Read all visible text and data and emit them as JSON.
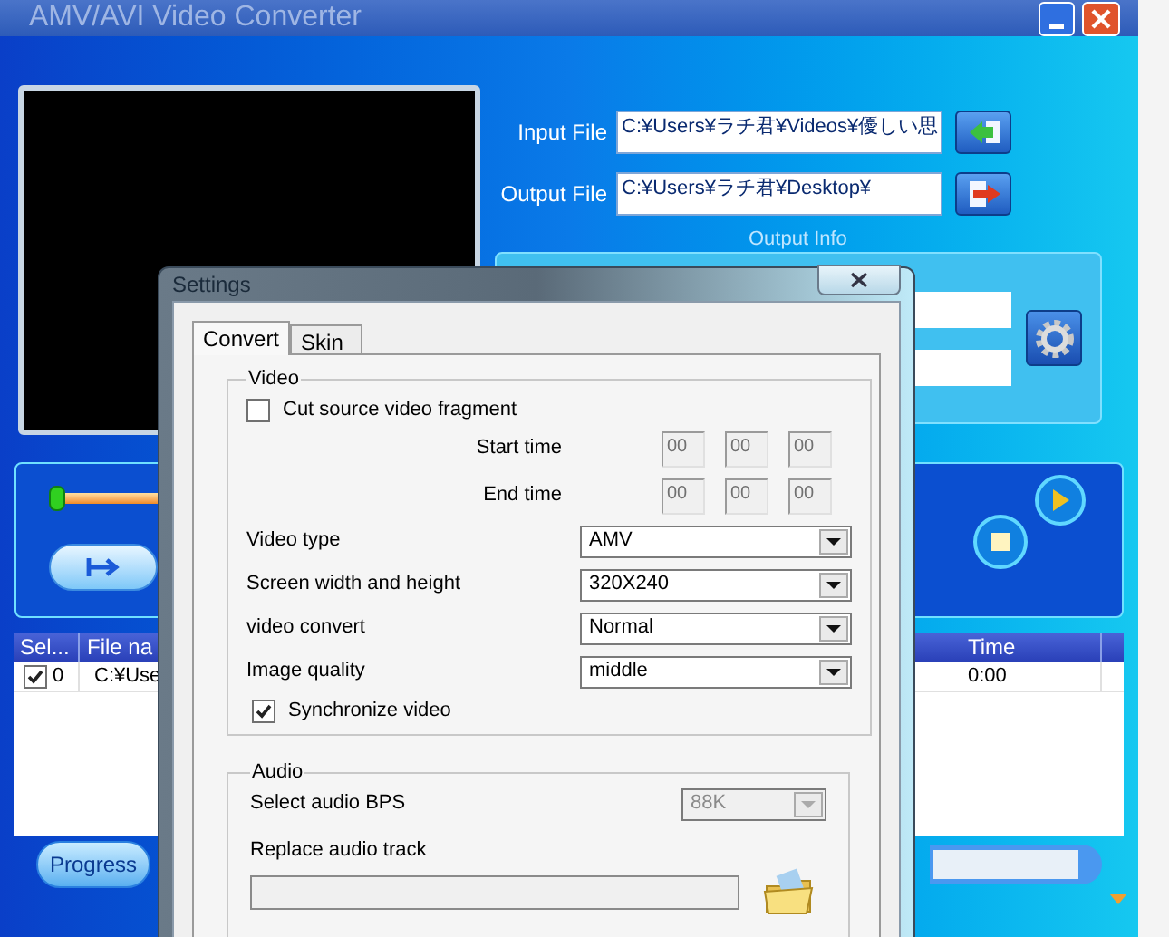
{
  "window": {
    "title": "AMV/AVI Video Converter"
  },
  "files": {
    "input_label": "Input File",
    "input_value": "C:¥Users¥ラチ君¥Videos¥優しい思",
    "output_label": "Output File",
    "output_value": "C:¥Users¥ラチ君¥Desktop¥"
  },
  "output_info": {
    "label": "Output Info"
  },
  "playback": {
    "level": 0
  },
  "table": {
    "columns": [
      "Sel...",
      "File na",
      "Time"
    ],
    "rows": [
      {
        "checked": true,
        "index": "0",
        "file": "C:¥Use",
        "time": "0:00"
      }
    ]
  },
  "progress": {
    "label": "Progress",
    "level": 0
  },
  "dialog": {
    "title": "Settings",
    "tabs": [
      {
        "label": "Convert",
        "selected": true
      },
      {
        "label": "Skin",
        "selected": false
      }
    ],
    "video": {
      "legend": "Video",
      "cut": {
        "label": "Cut source video fragment",
        "checked": false
      },
      "start_label": "Start time",
      "start": [
        "00",
        "00",
        "00"
      ],
      "end_label": "End time",
      "end": [
        "00",
        "00",
        "00"
      ],
      "selects": [
        {
          "label": "Video type",
          "value": "AMV"
        },
        {
          "label": "Screen width and height",
          "value": "320X240"
        },
        {
          "label": "video convert",
          "value": "Normal"
        },
        {
          "label": "Image quality",
          "value": "middle"
        }
      ],
      "sync": {
        "label": "Synchronize video",
        "checked": true
      }
    },
    "audio": {
      "legend": "Audio",
      "bps_label": "Select audio BPS",
      "bps_value": "88K",
      "bps_disabled": true,
      "replace_label": "Replace audio track"
    }
  }
}
